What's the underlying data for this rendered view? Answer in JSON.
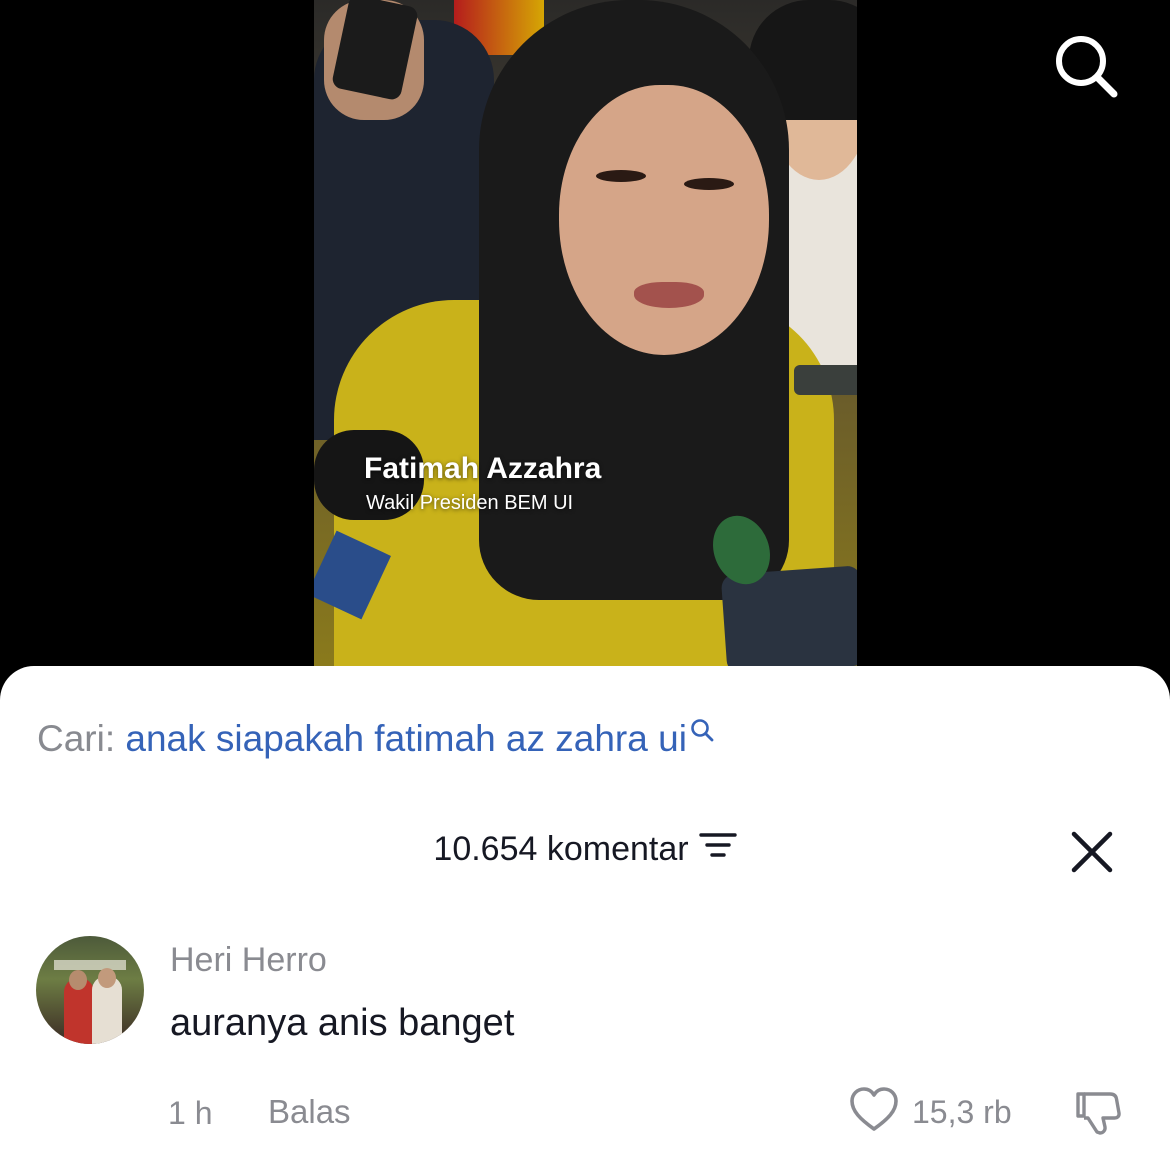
{
  "video": {
    "caption_name": "Fatimah Azzahra",
    "caption_title": "Wakil Presiden BEM UI",
    "search_icon": "search-icon"
  },
  "comments_panel": {
    "search_suggestion": {
      "prefix": "Cari:",
      "query": "anak siapakah fatimah az zahra ui",
      "icon": "search-icon"
    },
    "count_label": "10.654 komentar",
    "sort_icon": "sort-icon",
    "close_icon": "close-icon",
    "comments": [
      {
        "author": "Heri Herro",
        "text": "auranya anis banget",
        "time": "1 h",
        "reply_label": "Balas",
        "like_count": "15,3 rb",
        "like_icon": "heart-icon",
        "dislike_icon": "thumbs-down-icon"
      }
    ]
  },
  "colors": {
    "accent_link": "#3563b8",
    "text_primary": "#161823",
    "text_secondary": "#8a8b91",
    "background": "#ffffff"
  }
}
